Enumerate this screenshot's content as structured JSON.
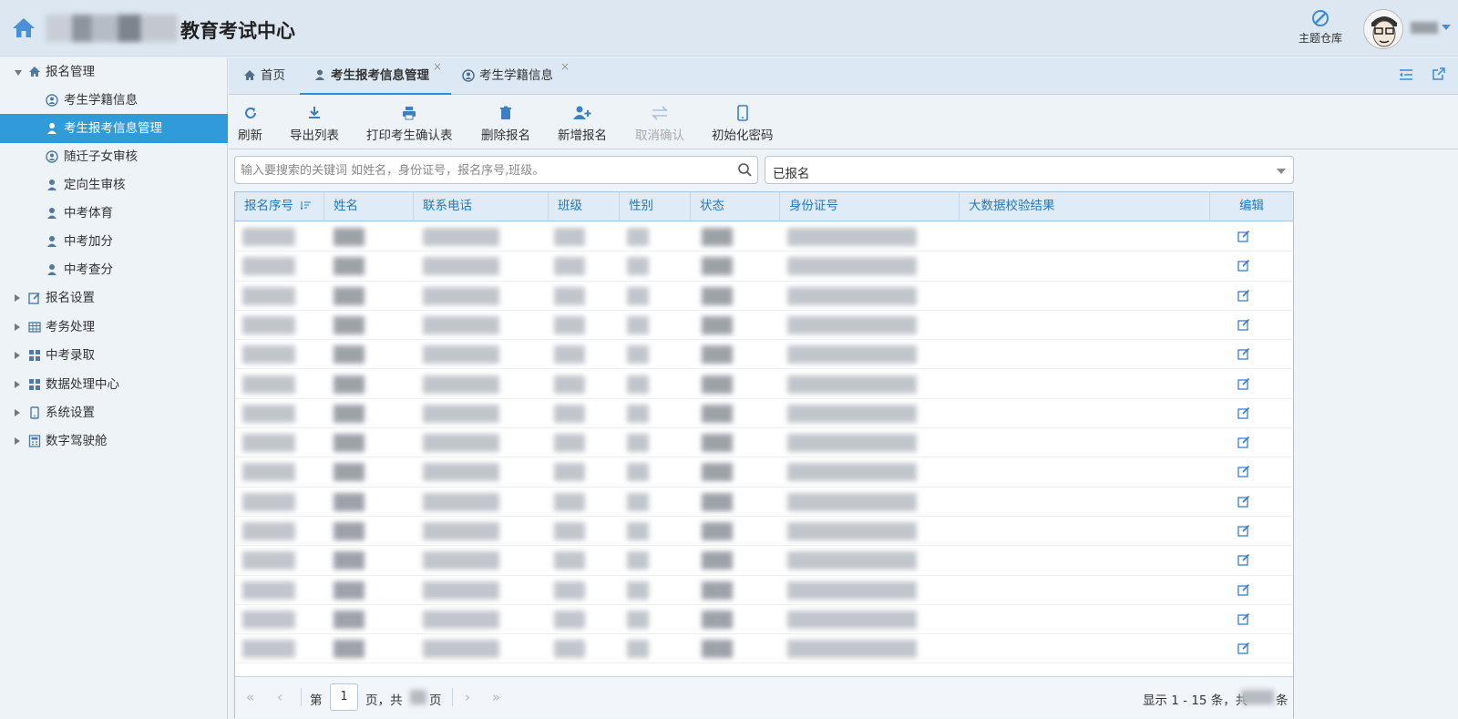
{
  "header": {
    "title": "教育考试中心",
    "theme_label": "主题仓库"
  },
  "sidebar": {
    "items": [
      {
        "label": "报名管理",
        "name": "sidebar-item-registration-management",
        "level": 0,
        "expanded": true,
        "icon": "home-icon"
      },
      {
        "label": "考生学籍信息",
        "name": "sidebar-item-student-records",
        "level": 1,
        "icon": "user-circle-icon"
      },
      {
        "label": "考生报考信息管理",
        "name": "sidebar-item-application-management",
        "level": 1,
        "icon": "user-icon",
        "active": true
      },
      {
        "label": "随迁子女审核",
        "name": "sidebar-item-migrant-children-review",
        "level": 1,
        "icon": "user-circle-icon"
      },
      {
        "label": "定向生审核",
        "name": "sidebar-item-directed-student-review",
        "level": 1,
        "icon": "user-icon"
      },
      {
        "label": "中考体育",
        "name": "sidebar-item-pe-exam",
        "level": 1,
        "icon": "user-icon"
      },
      {
        "label": "中考加分",
        "name": "sidebar-item-bonus-points",
        "level": 1,
        "icon": "user-icon"
      },
      {
        "label": "中考查分",
        "name": "sidebar-item-score-query",
        "level": 1,
        "icon": "user-icon"
      },
      {
        "label": "报名设置",
        "name": "sidebar-item-registration-settings",
        "level": 0,
        "icon": "edit-icon"
      },
      {
        "label": "考务处理",
        "name": "sidebar-item-exam-affairs",
        "level": 0,
        "icon": "table-icon"
      },
      {
        "label": "中考录取",
        "name": "sidebar-item-admission",
        "level": 0,
        "icon": "grid-icon"
      },
      {
        "label": "数据处理中心",
        "name": "sidebar-item-data-center",
        "level": 0,
        "icon": "grid-icon"
      },
      {
        "label": "系统设置",
        "name": "sidebar-item-system-settings",
        "level": 0,
        "icon": "mobile-icon"
      },
      {
        "label": "数字驾驶舱",
        "name": "sidebar-item-digital-cockpit",
        "level": 0,
        "icon": "calculator-icon"
      }
    ]
  },
  "tabs": [
    {
      "label": "首页",
      "closable": false
    },
    {
      "label": "考生报考信息管理",
      "closable": true,
      "active": true
    },
    {
      "label": "考生学籍信息",
      "closable": true
    }
  ],
  "tab_close_glyph": "×",
  "toolbar": {
    "refresh": "刷新",
    "export": "导出列表",
    "print": "打印考生确认表",
    "delete": "删除报名",
    "add": "新增报名",
    "cancel_confirm": "取消确认",
    "reset_password": "初始化密码"
  },
  "search": {
    "placeholder": "输入要搜索的关键词 如姓名，身份证号，报名序号,班级。"
  },
  "status_filter": {
    "selected": "已报名"
  },
  "grid": {
    "columns": [
      "报名序号",
      "姓名",
      "联系电话",
      "班级",
      "性别",
      "状态",
      "身份证号",
      "大数据校验结果",
      "编辑"
    ],
    "row_count": 15
  },
  "pager": {
    "page_prefix": "第",
    "current_page": "1",
    "page_suffix": "页，共",
    "page_end": "页",
    "summary_prefix": "显示 1 - 15 条，共",
    "summary_suffix": "条"
  },
  "colors": {
    "accent": "#2f9bd9",
    "header_bg": "#dce7f1",
    "grid_header_text": "#2778b8"
  }
}
